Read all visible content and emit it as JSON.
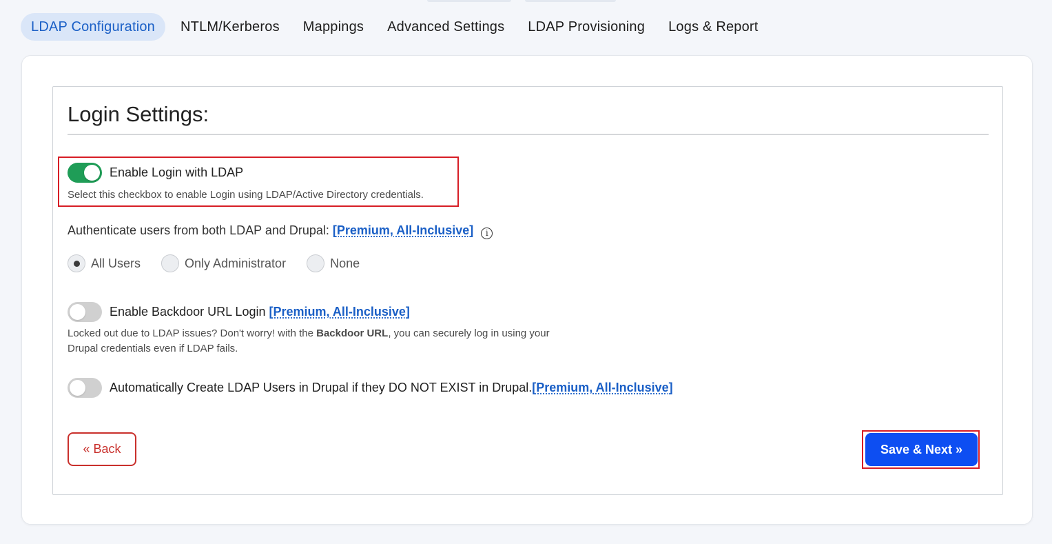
{
  "tabs": [
    {
      "label": "LDAP Configuration",
      "active": true
    },
    {
      "label": "NTLM/Kerberos",
      "active": false
    },
    {
      "label": "Mappings",
      "active": false
    },
    {
      "label": "Advanced Settings",
      "active": false
    },
    {
      "label": "LDAP Provisioning",
      "active": false
    },
    {
      "label": "Logs & Report",
      "active": false
    }
  ],
  "login_settings": {
    "title": "Login Settings:",
    "enable_login": {
      "label": "Enable Login with LDAP",
      "enabled": true,
      "help": "Select this checkbox to enable Login using LDAP/Active Directory credentials."
    },
    "authenticate": {
      "label": "Authenticate users from both LDAP and Drupal:",
      "premium": "[Premium, All-Inclusive]",
      "options": [
        "All Users",
        "Only Administrator",
        "None"
      ],
      "selected": "All Users"
    },
    "backdoor": {
      "label": "Enable Backdoor URL Login",
      "premium": "[Premium, All-Inclusive]",
      "enabled": false,
      "help_prefix": "Locked out due to LDAP issues? Don't worry! with the",
      "help_bold": "Backdoor URL",
      "help_suffix": ", you can securely log in using your",
      "help_line2": "Drupal credentials even if LDAP fails."
    },
    "auto_create": {
      "label": "Automatically Create LDAP Users in Drupal if they DO NOT EXIST in Drupal.",
      "premium": "[Premium, All-Inclusive]",
      "enabled": false
    }
  },
  "buttons": {
    "back": "« Back",
    "save_next": "Save & Next »"
  },
  "colors": {
    "accent_blue": "#0d4ef2",
    "link_blue": "#1a5fc6",
    "toggle_on": "#1f9d57",
    "highlight_red": "#d71d25"
  }
}
